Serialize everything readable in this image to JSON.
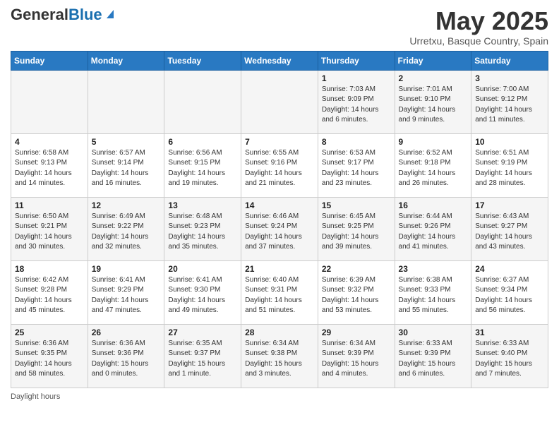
{
  "header": {
    "logo_general": "General",
    "logo_blue": "Blue",
    "month_title": "May 2025",
    "location": "Urretxu, Basque Country, Spain"
  },
  "days_of_week": [
    "Sunday",
    "Monday",
    "Tuesday",
    "Wednesday",
    "Thursday",
    "Friday",
    "Saturday"
  ],
  "weeks": [
    [
      {
        "day": "",
        "info": ""
      },
      {
        "day": "",
        "info": ""
      },
      {
        "day": "",
        "info": ""
      },
      {
        "day": "",
        "info": ""
      },
      {
        "day": "1",
        "info": "Sunrise: 7:03 AM\nSunset: 9:09 PM\nDaylight: 14 hours\nand 6 minutes."
      },
      {
        "day": "2",
        "info": "Sunrise: 7:01 AM\nSunset: 9:10 PM\nDaylight: 14 hours\nand 9 minutes."
      },
      {
        "day": "3",
        "info": "Sunrise: 7:00 AM\nSunset: 9:12 PM\nDaylight: 14 hours\nand 11 minutes."
      }
    ],
    [
      {
        "day": "4",
        "info": "Sunrise: 6:58 AM\nSunset: 9:13 PM\nDaylight: 14 hours\nand 14 minutes."
      },
      {
        "day": "5",
        "info": "Sunrise: 6:57 AM\nSunset: 9:14 PM\nDaylight: 14 hours\nand 16 minutes."
      },
      {
        "day": "6",
        "info": "Sunrise: 6:56 AM\nSunset: 9:15 PM\nDaylight: 14 hours\nand 19 minutes."
      },
      {
        "day": "7",
        "info": "Sunrise: 6:55 AM\nSunset: 9:16 PM\nDaylight: 14 hours\nand 21 minutes."
      },
      {
        "day": "8",
        "info": "Sunrise: 6:53 AM\nSunset: 9:17 PM\nDaylight: 14 hours\nand 23 minutes."
      },
      {
        "day": "9",
        "info": "Sunrise: 6:52 AM\nSunset: 9:18 PM\nDaylight: 14 hours\nand 26 minutes."
      },
      {
        "day": "10",
        "info": "Sunrise: 6:51 AM\nSunset: 9:19 PM\nDaylight: 14 hours\nand 28 minutes."
      }
    ],
    [
      {
        "day": "11",
        "info": "Sunrise: 6:50 AM\nSunset: 9:21 PM\nDaylight: 14 hours\nand 30 minutes."
      },
      {
        "day": "12",
        "info": "Sunrise: 6:49 AM\nSunset: 9:22 PM\nDaylight: 14 hours\nand 32 minutes."
      },
      {
        "day": "13",
        "info": "Sunrise: 6:48 AM\nSunset: 9:23 PM\nDaylight: 14 hours\nand 35 minutes."
      },
      {
        "day": "14",
        "info": "Sunrise: 6:46 AM\nSunset: 9:24 PM\nDaylight: 14 hours\nand 37 minutes."
      },
      {
        "day": "15",
        "info": "Sunrise: 6:45 AM\nSunset: 9:25 PM\nDaylight: 14 hours\nand 39 minutes."
      },
      {
        "day": "16",
        "info": "Sunrise: 6:44 AM\nSunset: 9:26 PM\nDaylight: 14 hours\nand 41 minutes."
      },
      {
        "day": "17",
        "info": "Sunrise: 6:43 AM\nSunset: 9:27 PM\nDaylight: 14 hours\nand 43 minutes."
      }
    ],
    [
      {
        "day": "18",
        "info": "Sunrise: 6:42 AM\nSunset: 9:28 PM\nDaylight: 14 hours\nand 45 minutes."
      },
      {
        "day": "19",
        "info": "Sunrise: 6:41 AM\nSunset: 9:29 PM\nDaylight: 14 hours\nand 47 minutes."
      },
      {
        "day": "20",
        "info": "Sunrise: 6:41 AM\nSunset: 9:30 PM\nDaylight: 14 hours\nand 49 minutes."
      },
      {
        "day": "21",
        "info": "Sunrise: 6:40 AM\nSunset: 9:31 PM\nDaylight: 14 hours\nand 51 minutes."
      },
      {
        "day": "22",
        "info": "Sunrise: 6:39 AM\nSunset: 9:32 PM\nDaylight: 14 hours\nand 53 minutes."
      },
      {
        "day": "23",
        "info": "Sunrise: 6:38 AM\nSunset: 9:33 PM\nDaylight: 14 hours\nand 55 minutes."
      },
      {
        "day": "24",
        "info": "Sunrise: 6:37 AM\nSunset: 9:34 PM\nDaylight: 14 hours\nand 56 minutes."
      }
    ],
    [
      {
        "day": "25",
        "info": "Sunrise: 6:36 AM\nSunset: 9:35 PM\nDaylight: 14 hours\nand 58 minutes."
      },
      {
        "day": "26",
        "info": "Sunrise: 6:36 AM\nSunset: 9:36 PM\nDaylight: 15 hours\nand 0 minutes."
      },
      {
        "day": "27",
        "info": "Sunrise: 6:35 AM\nSunset: 9:37 PM\nDaylight: 15 hours\nand 1 minute."
      },
      {
        "day": "28",
        "info": "Sunrise: 6:34 AM\nSunset: 9:38 PM\nDaylight: 15 hours\nand 3 minutes."
      },
      {
        "day": "29",
        "info": "Sunrise: 6:34 AM\nSunset: 9:39 PM\nDaylight: 15 hours\nand 4 minutes."
      },
      {
        "day": "30",
        "info": "Sunrise: 6:33 AM\nSunset: 9:39 PM\nDaylight: 15 hours\nand 6 minutes."
      },
      {
        "day": "31",
        "info": "Sunrise: 6:33 AM\nSunset: 9:40 PM\nDaylight: 15 hours\nand 7 minutes."
      }
    ]
  ],
  "footer": {
    "daylight_label": "Daylight hours"
  }
}
